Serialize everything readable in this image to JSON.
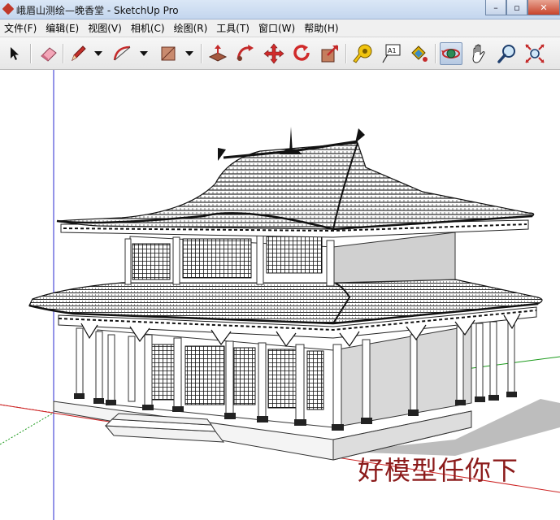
{
  "window": {
    "title": "峨眉山测绘—晚香堂 - SketchUp Pro",
    "controls": {
      "minimize": "–",
      "maximize": "▫",
      "close": "✕"
    }
  },
  "menubar": [
    {
      "label": "文件(F)"
    },
    {
      "label": "编辑(E)"
    },
    {
      "label": "视图(V)"
    },
    {
      "label": "相机(C)"
    },
    {
      "label": "绘图(R)"
    },
    {
      "label": "工具(T)"
    },
    {
      "label": "窗口(W)"
    },
    {
      "label": "帮助(H)"
    }
  ],
  "toolbar": {
    "tools": [
      {
        "name": "select-tool-button",
        "icon": "arrow-icon"
      },
      {
        "name": "eraser-tool-button",
        "icon": "eraser-icon"
      },
      {
        "name": "line-tool-button",
        "icon": "pencil-icon"
      },
      {
        "name": "arc-tool-button",
        "icon": "arc-icon"
      },
      {
        "name": "rectangle-tool-button",
        "icon": "rectangle-icon"
      },
      {
        "name": "push-pull-tool-button",
        "icon": "push-pull-icon"
      },
      {
        "name": "follow-me-tool-button",
        "icon": "follow-me-icon"
      },
      {
        "name": "move-tool-button",
        "icon": "move-icon"
      },
      {
        "name": "rotate-tool-button",
        "icon": "rotate-icon"
      },
      {
        "name": "scale-tool-button",
        "icon": "scale-icon"
      },
      {
        "name": "tape-measure-tool-button",
        "icon": "tape-measure-icon"
      },
      {
        "name": "text-tool-button",
        "icon": "text-icon"
      },
      {
        "name": "paint-bucket-tool-button",
        "icon": "paint-bucket-icon"
      },
      {
        "name": "orbit-tool-button",
        "icon": "orbit-icon",
        "active": true
      },
      {
        "name": "pan-tool-button",
        "icon": "hand-icon"
      },
      {
        "name": "zoom-tool-button",
        "icon": "magnifier-icon"
      },
      {
        "name": "zoom-extents-tool-button",
        "icon": "zoom-extents-icon"
      }
    ],
    "text_tool_glyph": "A1"
  },
  "viewport": {
    "watermark": "好模型任你下",
    "axis_colors": {
      "red": "#cc2222",
      "green": "#1b9a1b",
      "blue": "#2a2ad0"
    },
    "model": "chinese-two-storey-hall"
  },
  "colors": {
    "title_bar": "#c4d6ee",
    "menubar": "#f0f0f0",
    "toolbar": "#ececec",
    "watermark": "#8b1a1a"
  }
}
